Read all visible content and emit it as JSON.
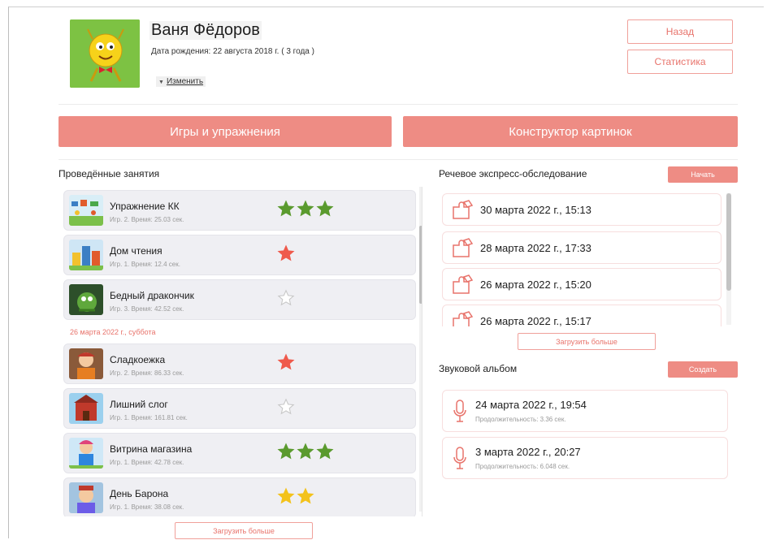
{
  "profile": {
    "name": "Ваня Фёдоров",
    "birth": "Дата рождения: 22 августа 2018 г. ( 3 года )",
    "edit_label": "Изменить"
  },
  "header_buttons": {
    "back": "Назад",
    "stats": "Статистика"
  },
  "main_buttons": {
    "games": "Игры и упражнения",
    "constructor": "Конструктор картинок"
  },
  "lessons": {
    "title": "Проведённые занятия",
    "date_separator": "26 марта 2022 г., суббота",
    "load_more": "Загрузить больше",
    "items": [
      {
        "title": "Упражнение КК",
        "meta": "Игр. 2. Время: 25.03 сек.",
        "stars": 3,
        "star_color": "#5a9a2e"
      },
      {
        "title": "Дом чтения",
        "meta": "Игр. 1. Время: 12.4 сек.",
        "stars": 1,
        "star_color": "#ef5a4c"
      },
      {
        "title": "Бедный дракончик",
        "meta": "Игр. 3. Время: 42.52 сек.",
        "stars": 0,
        "star_color": "#cccccc"
      },
      {
        "title": "Сладкоежка",
        "meta": "Игр. 2. Время: 86.33 сек.",
        "stars": 1,
        "star_color": "#ef5a4c"
      },
      {
        "title": "Лишний слог",
        "meta": "Игр. 1. Время: 161.81 сек.",
        "stars": 0,
        "star_color": "#cccccc"
      },
      {
        "title": "Витрина магазина",
        "meta": "Игр. 1. Время: 42.78 сек.",
        "stars": 3,
        "star_color": "#5a9a2e"
      },
      {
        "title": "День Барона",
        "meta": "Игр. 1. Время: 38.08 сек.",
        "stars": 2,
        "star_color": "#f3c21b"
      }
    ]
  },
  "exams": {
    "title": "Речевое экспресс-обследование",
    "start": "Начать",
    "load_more": "Загрузить больше",
    "items": [
      "30 марта 2022 г., 15:13",
      "28 марта 2022 г., 17:33",
      "26 марта 2022 г., 15:20",
      "26 марта 2022 г., 15:17"
    ]
  },
  "album": {
    "title": "Звуковой альбом",
    "create": "Создать",
    "items": [
      {
        "title": "24 марта 2022 г., 19:54",
        "duration": "Продолжительность: 3.36 сек."
      },
      {
        "title": "3 марта 2022 г., 20:27",
        "duration": "Продолжительность: 6.048 сек."
      }
    ]
  },
  "colors": {
    "accent": "#ee8c84",
    "accent_text": "#e8736b",
    "row_bg": "#efeff3"
  }
}
